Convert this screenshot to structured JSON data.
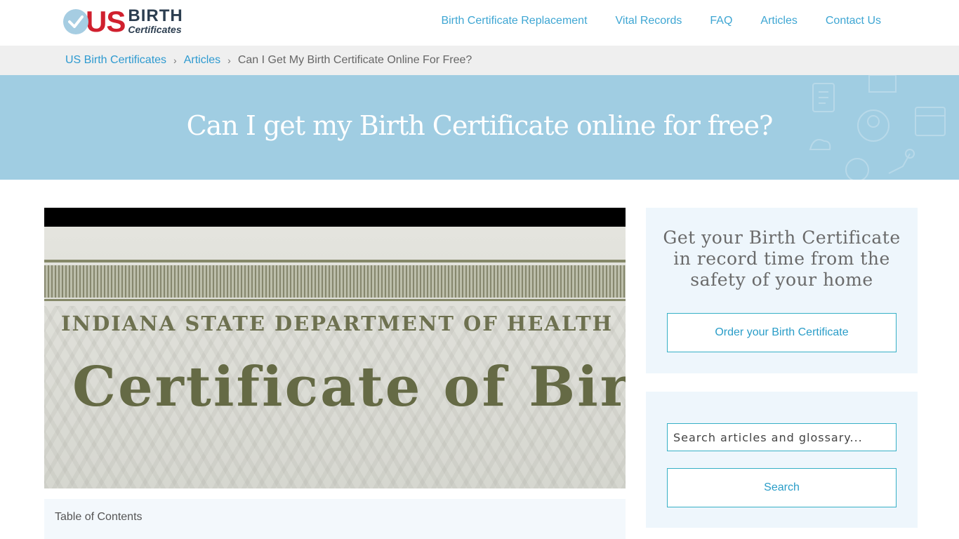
{
  "brand": {
    "us": "US",
    "birth": "BIRTH",
    "certificates": "Certificates"
  },
  "nav": [
    {
      "label": "Birth Certificate Replacement"
    },
    {
      "label": "Vital Records"
    },
    {
      "label": "FAQ"
    },
    {
      "label": "Articles"
    },
    {
      "label": "Contact Us"
    }
  ],
  "breadcrumb": {
    "home": "US Birth Certificates",
    "section": "Articles",
    "current": "Can I Get My Birth Certificate Online For Free?",
    "separator": "›"
  },
  "hero": {
    "title": "Can I get my Birth Certificate online for free?"
  },
  "image": {
    "line1": "INDIANA STATE DEPARTMENT OF HEALTH",
    "line2": "Certificate of Birth"
  },
  "toc": {
    "label": "Table of Contents"
  },
  "cta": {
    "text": "Get your Birth Certificate in record time from the safety of your home",
    "button": "Order your Birth Certificate"
  },
  "search": {
    "placeholder": "Search articles and glossary...",
    "button": "Search"
  },
  "colors": {
    "accent": "#3ea6d3",
    "brand_red": "#d0202e",
    "hero_bg": "#a0cde2",
    "panel_bg": "#eef6fc"
  }
}
